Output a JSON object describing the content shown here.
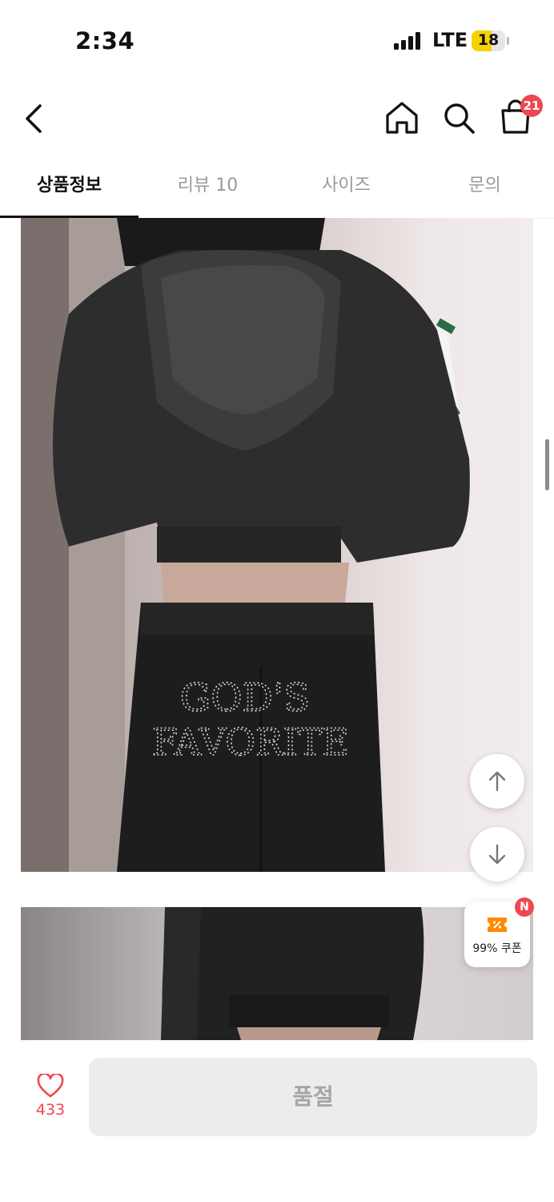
{
  "status_bar": {
    "time": "2:34",
    "network": "LTE",
    "battery": "18"
  },
  "header": {
    "cart_count": "21"
  },
  "tabs": [
    {
      "label": "상품정보",
      "active": true
    },
    {
      "label": "리뷰 10",
      "active": false
    },
    {
      "label": "사이즈",
      "active": false
    },
    {
      "label": "문의",
      "active": false
    }
  ],
  "images": {
    "print_line1": "GOD'S",
    "print_line2": "FAVORITE"
  },
  "floating": {
    "coupon_badge": "N",
    "coupon_label": "99% 쿠폰"
  },
  "bottom_bar": {
    "like_count": "433",
    "cta_label": "품절"
  },
  "colors": {
    "accent": "#f0474f",
    "battery": "#f5d200",
    "coupon": "#ff8a00"
  }
}
